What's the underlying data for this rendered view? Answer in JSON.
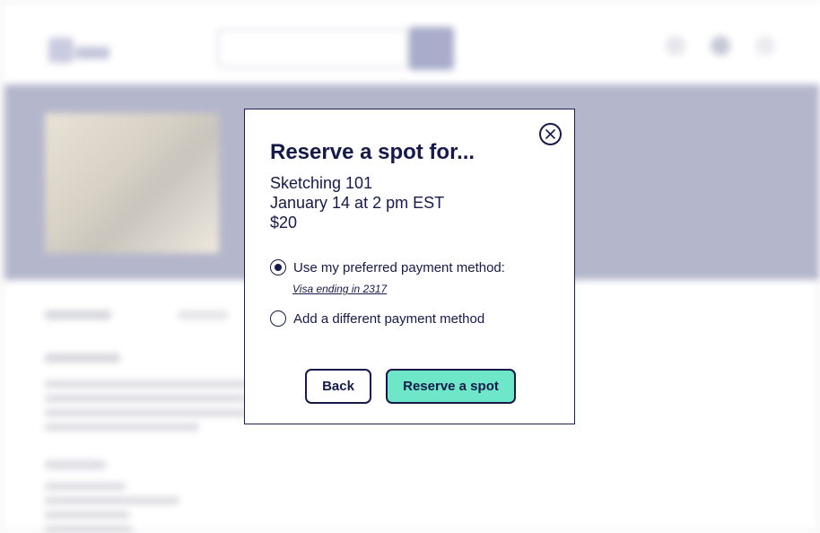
{
  "colors": {
    "brand_navy": "#151a4a",
    "accent_teal": "#6ee7c9",
    "banner_bg": "#b4b6cc",
    "search_button": "#a9acca"
  },
  "header": {
    "icons": [
      "search-icon",
      "user-icon",
      "cart-icon"
    ]
  },
  "modal": {
    "title": "Reserve a spot for...",
    "class_name": "Sketching 101",
    "date_time": "January 14 at 2 pm EST",
    "price": "$20",
    "payment_options": [
      {
        "label": "Use my preferred payment method:",
        "selected": true
      },
      {
        "label": "Add a different payment method",
        "selected": false
      }
    ],
    "preferred_card": "Visa ending in 2317",
    "back_label": "Back",
    "reserve_label": "Reserve a spot",
    "close_icon": "close-circle-icon"
  }
}
